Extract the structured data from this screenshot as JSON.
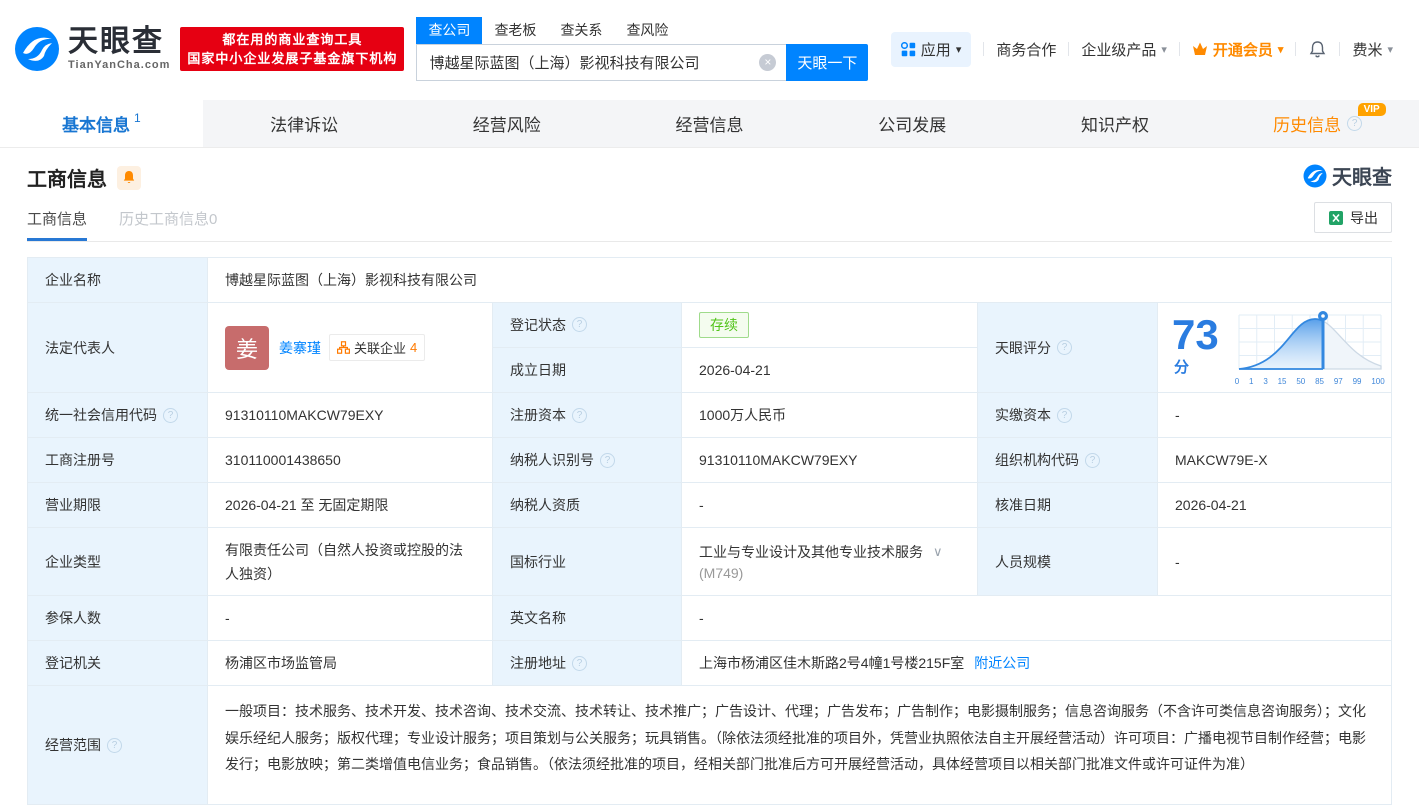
{
  "colors": {
    "brand_blue": "#0084ff",
    "accent_orange": "#ff8a00",
    "status_green": "#52c41a",
    "banner_red": "#e60012",
    "score_blue": "#2a7ce0"
  },
  "icons": {
    "question": "?",
    "caret_down": "▾",
    "chevron_down": "∨",
    "close": "×"
  },
  "header": {
    "logo": {
      "title": "天眼查",
      "subtitle": "TianYanCha.com"
    },
    "banner": {
      "line1": "都在用的商业查询工具",
      "line2": "国家中小企业发展子基金旗下机构"
    },
    "search": {
      "tabs": [
        {
          "label": "查公司"
        },
        {
          "label": "查老板"
        },
        {
          "label": "查关系"
        },
        {
          "label": "查风险"
        }
      ],
      "value": "博越星际蓝图（上海）影视科技有限公司",
      "button": "天眼一下"
    },
    "nav": {
      "apps": "应用",
      "cooperation": "商务合作",
      "enterprise": "企业级产品",
      "vip": "开通会员",
      "user": "费米"
    }
  },
  "tabs": [
    {
      "label": "基本信息",
      "count": "1"
    },
    {
      "label": "法律诉讼"
    },
    {
      "label": "经营风险"
    },
    {
      "label": "经营信息"
    },
    {
      "label": "公司发展"
    },
    {
      "label": "知识产权"
    },
    {
      "label": "历史信息",
      "badge": "VIP"
    }
  ],
  "section": {
    "title": "工商信息",
    "watermark": "天眼查",
    "subtabs": [
      {
        "label": "工商信息"
      },
      {
        "label": "历史工商信息0"
      }
    ],
    "export": "导出"
  },
  "table": {
    "company_name": {
      "label": "企业名称",
      "value": "博越星际蓝图（上海）影视科技有限公司"
    },
    "legal_rep": {
      "label": "法定代表人",
      "avatar": "姜",
      "name": "姜寨瑾",
      "related_label": "关联企业",
      "related_count": "4"
    },
    "reg_status": {
      "label": "登记状态",
      "value": "存续"
    },
    "establish_date": {
      "label": "成立日期",
      "value": "2026-04-21"
    },
    "score": {
      "label": "天眼评分",
      "value": "73",
      "unit": "分",
      "axis": [
        "0",
        "1",
        "3",
        "15",
        "50",
        "85",
        "97",
        "99",
        "100"
      ]
    },
    "credit_code": {
      "label": "统一社会信用代码",
      "value": "91310110MAKCW79EXY"
    },
    "reg_capital": {
      "label": "注册资本",
      "value": "1000万人民币"
    },
    "paid_capital": {
      "label": "实缴资本",
      "value": "-"
    },
    "reg_number": {
      "label": "工商注册号",
      "value": "310110001438650"
    },
    "taxpayer_id": {
      "label": "纳税人识别号",
      "value": "91310110MAKCW79EXY"
    },
    "org_code": {
      "label": "组织机构代码",
      "value": "MAKCW79E-X"
    },
    "business_term": {
      "label": "营业期限",
      "value": "2026-04-21 至 无固定期限"
    },
    "taxpayer_quality": {
      "label": "纳税人资质",
      "value": "-"
    },
    "approval_date": {
      "label": "核准日期",
      "value": "2026-04-21"
    },
    "company_type": {
      "label": "企业类型",
      "value": "有限责任公司（自然人投资或控股的法人独资）"
    },
    "industry": {
      "label": "国标行业",
      "value": "工业与专业设计及其他专业技术服务",
      "code": "(M749)"
    },
    "staff_size": {
      "label": "人员规模",
      "value": "-"
    },
    "insured_count": {
      "label": "参保人数",
      "value": "-"
    },
    "english_name": {
      "label": "英文名称",
      "value": "-"
    },
    "reg_authority": {
      "label": "登记机关",
      "value": "杨浦区市场监管局"
    },
    "reg_address": {
      "label": "注册地址",
      "value": "上海市杨浦区佳木斯路2号4幢1号楼215F室",
      "nearby": "附近公司"
    },
    "business_scope": {
      "label": "经营范围",
      "value": "一般项目：技术服务、技术开发、技术咨询、技术交流、技术转让、技术推广；广告设计、代理；广告发布；广告制作；电影摄制服务；信息咨询服务（不含许可类信息咨询服务）；文化娱乐经纪人服务；版权代理；专业设计服务；项目策划与公关服务；玩具销售。（除依法须经批准的项目外，凭营业执照依法自主开展经营活动）许可项目：广播电视节目制作经营；电影发行；电影放映；第二类增值电信业务；食品销售。（依法须经批准的项目，经相关部门批准后方可开展经营活动，具体经营项目以相关部门批准文件或许可证件为准）"
    }
  }
}
